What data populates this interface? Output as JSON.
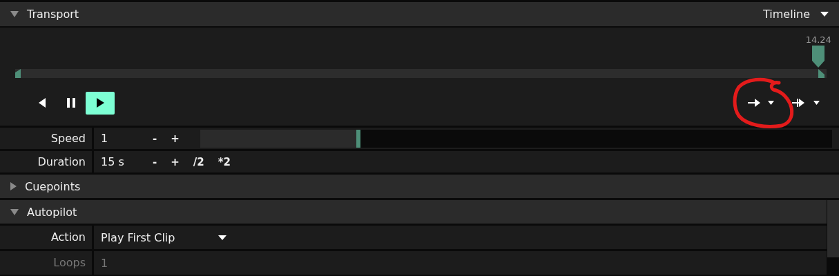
{
  "transport": {
    "title": "Transport",
    "expanded": true,
    "mode": "Timeline",
    "time": "14.24",
    "playhead": {
      "level": 0.99
    },
    "buttons": [
      {
        "kind": "back",
        "selected": false
      },
      {
        "kind": "pause",
        "selected": false
      },
      {
        "kind": "play",
        "selected": true
      }
    ]
  },
  "params": [
    {
      "label": "Speed",
      "value": "1",
      "kind": "slider",
      "controls": [
        "-",
        "+"
      ],
      "level": 0.25
    },
    {
      "label": "Duration",
      "value": "15 s",
      "kind": "plain",
      "controls": [
        "-",
        "+",
        "/2",
        "*2"
      ]
    }
  ],
  "sections": [
    {
      "title": "Cuepoints",
      "expanded": false
    },
    {
      "title": "Autopilot",
      "expanded": true,
      "rows": [
        {
          "label": "Action",
          "value": "Play First Clip",
          "kind": "dropdown",
          "disabled": false
        },
        {
          "label": "Loops",
          "value": "1",
          "kind": "plain",
          "disabled": true
        }
      ]
    }
  ]
}
